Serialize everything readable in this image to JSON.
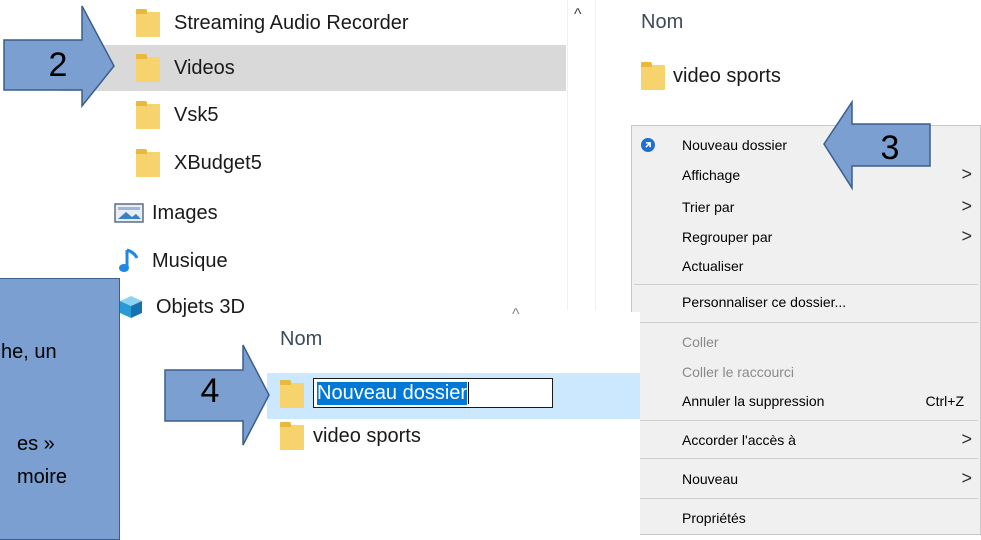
{
  "nav": {
    "items": [
      {
        "label": "Streaming Audio Recorder",
        "icon": "folder-icon",
        "selected": false
      },
      {
        "label": "Videos",
        "icon": "folder-icon",
        "selected": true
      },
      {
        "label": "Vsk5",
        "icon": "folder-icon",
        "selected": false
      },
      {
        "label": "XBudget5",
        "icon": "folder-icon",
        "selected": false
      },
      {
        "label": "Images",
        "icon": "pictures-icon",
        "selected": false
      },
      {
        "label": "Musique",
        "icon": "music-note-icon",
        "selected": false
      },
      {
        "label": "Objets 3D",
        "icon": "cube-3d-icon",
        "selected": false
      }
    ],
    "scroll_up": "^"
  },
  "upper_list": {
    "header": "Nom",
    "items": [
      {
        "label": "video sports"
      }
    ]
  },
  "context_menu": {
    "items": [
      {
        "label": "Nouveau dossier",
        "icon": "new-folder-icon"
      },
      {
        "label": "Affichage",
        "submenu": ">"
      },
      {
        "label": "Trier par",
        "submenu": ">"
      },
      {
        "label": "Regrouper par",
        "submenu": ">"
      },
      {
        "label": "Actualiser"
      },
      {
        "label": "Personnaliser ce dossier..."
      },
      {
        "label": "Coller",
        "disabled": true
      },
      {
        "label": "Coller le raccourci",
        "disabled": true
      },
      {
        "label": "Annuler la suppression",
        "shortcut": "Ctrl+Z"
      },
      {
        "label": "Accorder l'accès à",
        "submenu": ">"
      },
      {
        "label": "Nouveau",
        "submenu": ">"
      },
      {
        "label": "Propriétés"
      }
    ]
  },
  "lower_list": {
    "header": "Nom",
    "scroll_up": "^",
    "rename_value": "Nouveau dossier",
    "items": [
      {
        "label": "video sports"
      }
    ]
  },
  "callouts": {
    "n2": "2",
    "n3": "3",
    "n4": "4",
    "box_lines": [
      "he, un",
      "es »",
      "moire"
    ]
  },
  "colors": {
    "callout_fill": "#7a9fd0",
    "selection": "#cce8ff",
    "nav_selected": "#d9d9d9",
    "text_selection": "#0078d7"
  }
}
